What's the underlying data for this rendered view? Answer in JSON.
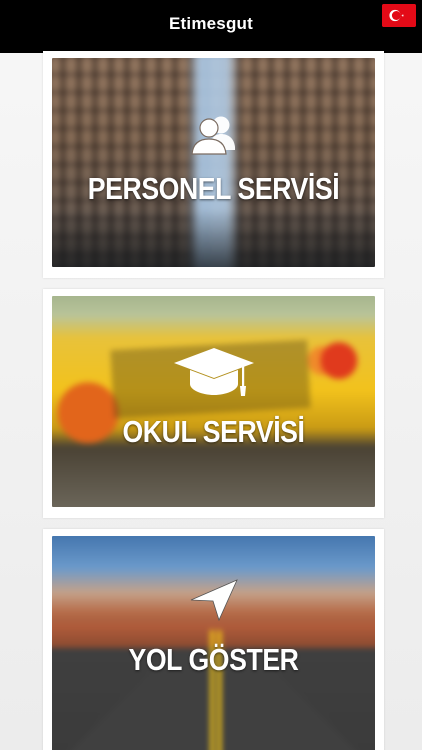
{
  "header": {
    "title": "Etimesgut",
    "flag_icon": "turkey-flag-icon"
  },
  "menu": [
    {
      "label": "PERSONEL SERVİSİ",
      "icon": "users-icon",
      "background": "city-street"
    },
    {
      "label": "OKUL SERVİSİ",
      "icon": "graduation-cap-icon",
      "background": "school-bus"
    },
    {
      "label": "YOL GÖSTER",
      "icon": "navigation-arrow-icon",
      "background": "road"
    }
  ],
  "colors": {
    "navbar": "#000000",
    "flag_red": "#e30a17",
    "card": "#ffffff",
    "label_text": "#ffffff"
  }
}
